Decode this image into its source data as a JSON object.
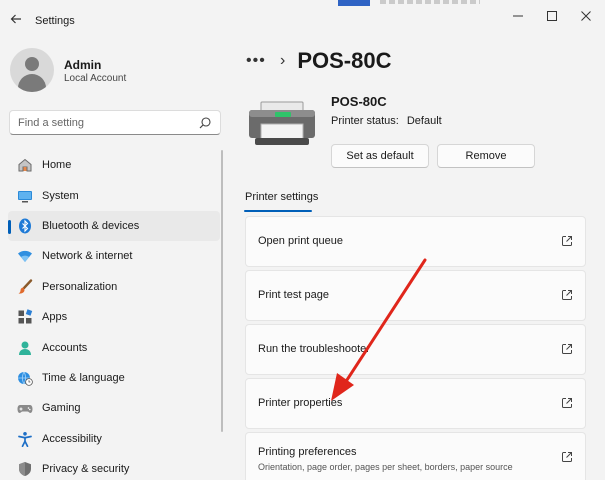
{
  "window": {
    "title": "Settings",
    "colors": {
      "accent": "#005fb8",
      "arrow": "#e0261b",
      "background": "#f3f3f3"
    }
  },
  "user": {
    "name": "Admin",
    "type": "Local Account"
  },
  "search": {
    "placeholder": "Find a setting"
  },
  "sidebar": {
    "items": [
      {
        "label": "Home",
        "icon": "home-icon"
      },
      {
        "label": "System",
        "icon": "monitor-icon"
      },
      {
        "label": "Bluetooth & devices",
        "icon": "bluetooth-icon",
        "active": true
      },
      {
        "label": "Network & internet",
        "icon": "wifi-icon"
      },
      {
        "label": "Personalization",
        "icon": "brush-icon"
      },
      {
        "label": "Apps",
        "icon": "apps-icon"
      },
      {
        "label": "Accounts",
        "icon": "person-icon"
      },
      {
        "label": "Time & language",
        "icon": "globe-clock-icon"
      },
      {
        "label": "Gaming",
        "icon": "gamepad-icon"
      },
      {
        "label": "Accessibility",
        "icon": "accessibility-icon"
      },
      {
        "label": "Privacy & security",
        "icon": "shield-icon"
      }
    ]
  },
  "breadcrumb": {
    "dots": "•••",
    "separator": "›",
    "title": "POS-80C"
  },
  "printer": {
    "name": "POS-80C",
    "status_label": "Printer status:",
    "status_value": "Default",
    "set_default_label": "Set as default",
    "remove_label": "Remove"
  },
  "tab": {
    "label": "Printer settings"
  },
  "cards": [
    {
      "label": "Open print queue"
    },
    {
      "label": "Print test page"
    },
    {
      "label": "Run the troubleshooter"
    },
    {
      "label": "Printer properties"
    },
    {
      "label": "Printing preferences",
      "sub": "Orientation, page order, pages per sheet, borders, paper source"
    }
  ]
}
